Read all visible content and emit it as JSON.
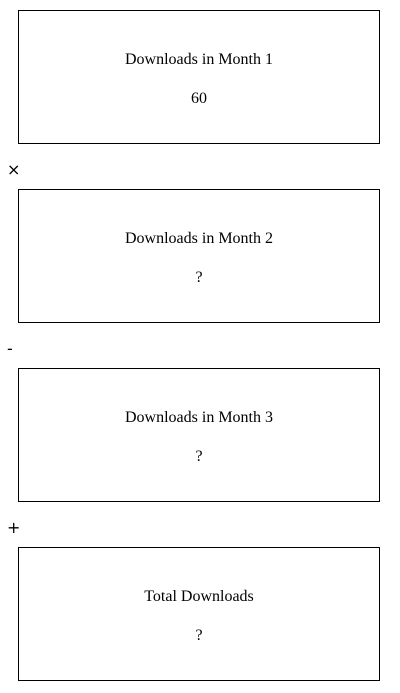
{
  "boxes": [
    {
      "title": "Downloads in Month 1",
      "value": "60"
    },
    {
      "title": "Downloads in Month 2",
      "value": "?"
    },
    {
      "title": "Downloads in Month 3",
      "value": "?"
    },
    {
      "title": "Total Downloads",
      "value": "?"
    }
  ],
  "operators": [
    "×",
    "-",
    "+"
  ]
}
